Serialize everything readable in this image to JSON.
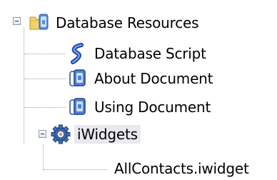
{
  "tree": {
    "root": {
      "label": "Database Resources",
      "icon": "folder-database-icon",
      "expanded": true,
      "children": [
        {
          "label": "Database Script",
          "icon": "database-script-icon"
        },
        {
          "label": "About Document",
          "icon": "document-icon"
        },
        {
          "label": "Using Document",
          "icon": "document-icon"
        },
        {
          "label": "iWidgets",
          "icon": "gear-widget-icon",
          "expanded": true,
          "selected": true,
          "children": [
            {
              "label": "AllContacts.iwidget"
            }
          ]
        }
      ]
    }
  }
}
